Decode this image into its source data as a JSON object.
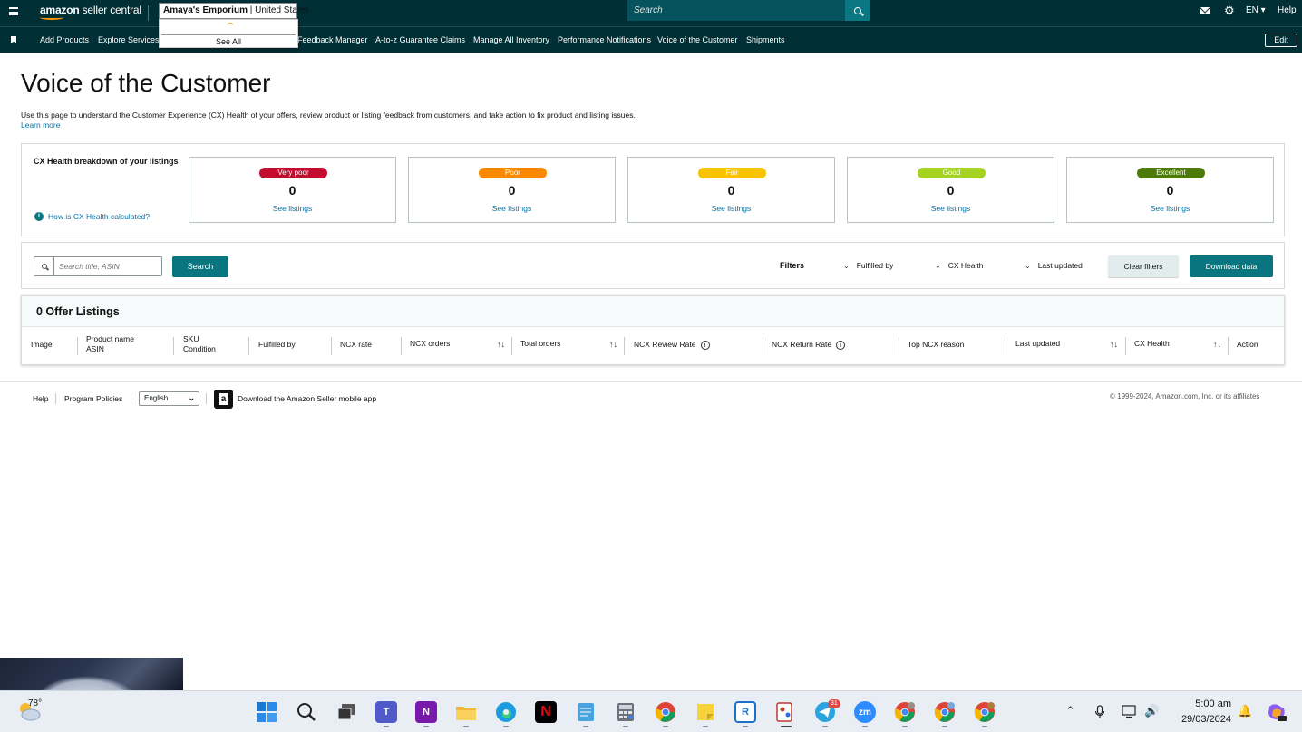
{
  "topbar": {
    "logo_bold": "amazon",
    "logo_light": " seller central",
    "account_store": "Amaya's Emporium",
    "account_region": " | United States",
    "dropdown_see_all": "See All",
    "search_placeholder": "Search",
    "language": "EN ▾",
    "help": "Help"
  },
  "nav": {
    "items": [
      "Add Products",
      "Explore Services",
      "Feedback Manager",
      "A-to-z Guarantee Claims",
      "Manage All Inventory",
      "Performance Notifications",
      "Voice of the Customer",
      "Shipments"
    ],
    "edit": "Edit"
  },
  "page": {
    "title": "Voice of the Customer",
    "description": "Use this page to understand the Customer Experience (CX) Health of your offers, review product or listing feedback from customers, and take action to fix product and listing issues.",
    "learn_more": "Learn more"
  },
  "cx_health": {
    "heading": "CX Health breakdown of your listings",
    "how_calculated": "How is CX Health calculated?",
    "info_glyph": "i",
    "cards": [
      {
        "label": "Very poor",
        "count": "0",
        "link": "See listings",
        "color": "#c40c2f"
      },
      {
        "label": "Poor",
        "count": "0",
        "link": "See listings",
        "color": "#fa8900"
      },
      {
        "label": "Fair",
        "count": "0",
        "link": "See listings",
        "color": "#f9c300"
      },
      {
        "label": "Good",
        "count": "0",
        "link": "See listings",
        "color": "#a6d31f"
      },
      {
        "label": "Excellent",
        "count": "0",
        "link": "See listings",
        "color": "#4d7b07"
      }
    ]
  },
  "search": {
    "placeholder": "Search title, ASIN",
    "button": "Search",
    "filters_label": "Filters",
    "filter_fulfilled": "Fulfilled by",
    "filter_cx": "CX Health",
    "filter_updated": "Last updated",
    "clear_filters": "Clear filters",
    "download": "Download data"
  },
  "listings": {
    "title": "0 Offer Listings",
    "columns": {
      "image": "Image",
      "product_name": "Product name",
      "asin": "ASIN",
      "sku": "SKU",
      "condition": "Condition",
      "fulfilled_by": "Fulfilled by",
      "ncx_rate": "NCX rate",
      "ncx_orders": "NCX orders",
      "total_orders": "Total orders",
      "ncx_review_rate": "NCX Review Rate",
      "ncx_return_rate": "NCX Return Rate",
      "top_ncx_reason": "Top NCX reason",
      "last_updated": "Last updated",
      "cx_health": "CX Health",
      "action": "Action"
    },
    "sort_glyph": "↑↓",
    "info_glyph": "i"
  },
  "footer": {
    "help": "Help",
    "program_policies": "Program Policies",
    "language": "English",
    "app_text": "Download the Amazon Seller mobile app",
    "copyright": "© 1999-2024, Amazon.com, Inc. or its affiliates"
  },
  "taskbar": {
    "temperature": "78°",
    "time": "5:00 am",
    "date": "29/03/2024",
    "telegram_badge": "31"
  },
  "icons": {
    "menu": "hamburger-icon",
    "mail": "mail-icon",
    "settings": "gear-icon",
    "search": "search-icon",
    "info": "info-icon",
    "sort": "sort-icon",
    "chevron": "chevron-down-icon"
  }
}
